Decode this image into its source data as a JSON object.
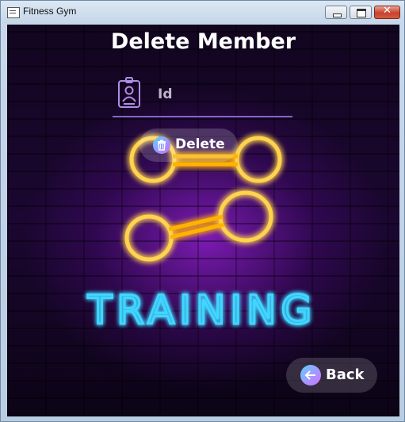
{
  "window": {
    "title": "Fitness Gym",
    "close_glyph": "✕"
  },
  "page": {
    "title": "Delete Member"
  },
  "id_field": {
    "placeholder": "Id",
    "value": "",
    "icon": "id-badge-icon"
  },
  "delete_button": {
    "label": "Delete",
    "icon": "trash-icon"
  },
  "back_button": {
    "label": "Back",
    "icon": "arrow-left-icon"
  },
  "artwork": {
    "text": "TRAINING",
    "text_color": "#3fd6ff",
    "dumbbell_color": "#ffb300"
  },
  "colors": {
    "background": "#1b0731",
    "accent": "#7f68c4",
    "glow": "#8c1ec8"
  }
}
